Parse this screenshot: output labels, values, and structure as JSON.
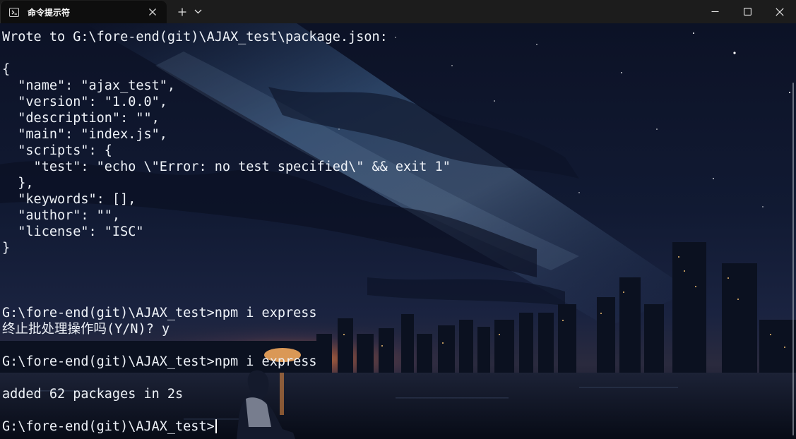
{
  "window": {
    "tab_title": "命令提示符",
    "tab_icon": "terminal-icon"
  },
  "terminal": {
    "lines": [
      "Wrote to G:\\fore-end(git)\\AJAX_test\\package.json:",
      "",
      "{",
      "  \"name\": \"ajax_test\",",
      "  \"version\": \"1.0.0\",",
      "  \"description\": \"\",",
      "  \"main\": \"index.js\",",
      "  \"scripts\": {",
      "    \"test\": \"echo \\\"Error: no test specified\\\" && exit 1\"",
      "  },",
      "  \"keywords\": [],",
      "  \"author\": \"\",",
      "  \"license\": \"ISC\"",
      "}",
      "",
      "",
      "",
      "G:\\fore-end(git)\\AJAX_test>npm i express",
      "终止批处理操作吗(Y/N)? y",
      "",
      "G:\\fore-end(git)\\AJAX_test>npm i express",
      "",
      "added 62 packages in 2s",
      "",
      "G:\\fore-end(git)\\AJAX_test>"
    ],
    "text_color": "#eef2f8"
  },
  "colors": {
    "titlebar": "#1c1c1c",
    "active_tab": "#0e0e0e",
    "sky_top": "#0a1024",
    "sunset": "#ff8a3d"
  }
}
